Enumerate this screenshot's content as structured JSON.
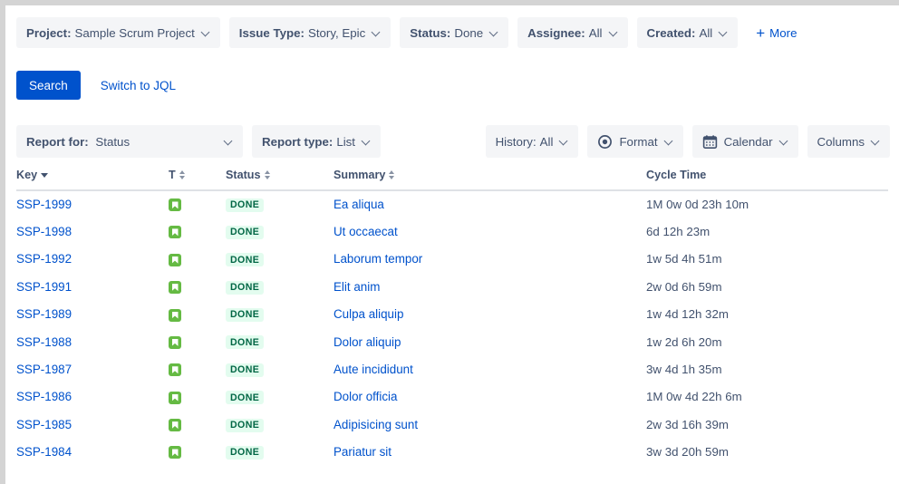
{
  "filters": [
    {
      "label": "Project:",
      "value": "Sample Scrum Project",
      "name": "filter-project"
    },
    {
      "label": "Issue Type:",
      "value": "Story, Epic",
      "name": "filter-issue-type"
    },
    {
      "label": "Status:",
      "value": "Done",
      "name": "filter-status"
    },
    {
      "label": "Assignee:",
      "value": "All",
      "name": "filter-assignee"
    },
    {
      "label": "Created:",
      "value": "All",
      "name": "filter-created"
    }
  ],
  "more_button": {
    "plus": "+",
    "label": "More"
  },
  "actions": {
    "search_label": "Search",
    "jql_label": "Switch to JQL"
  },
  "report_controls": {
    "report_for_label": "Report for:",
    "report_for_value": "Status",
    "report_type_label": "Report type:",
    "report_type_value": "List",
    "history_label": "History:",
    "history_value": "All",
    "format_label": "Format",
    "calendar_label": "Calendar",
    "columns_label": "Columns"
  },
  "table": {
    "headers": {
      "key": "Key",
      "type": "T",
      "status": "Status",
      "summary": "Summary",
      "cycle_time": "Cycle Time"
    },
    "rows": [
      {
        "key": "SSP-1999",
        "type_icon": "story-icon",
        "status": "DONE",
        "summary": "Ea aliqua",
        "cycle_time": "1M 0w 0d 23h 10m"
      },
      {
        "key": "SSP-1998",
        "type_icon": "story-icon",
        "status": "DONE",
        "summary": "Ut occaecat",
        "cycle_time": "6d 12h 23m"
      },
      {
        "key": "SSP-1992",
        "type_icon": "story-icon",
        "status": "DONE",
        "summary": "Laborum tempor",
        "cycle_time": "1w 5d 4h 51m"
      },
      {
        "key": "SSP-1991",
        "type_icon": "story-icon",
        "status": "DONE",
        "summary": "Elit anim",
        "cycle_time": "2w 0d 6h 59m"
      },
      {
        "key": "SSP-1989",
        "type_icon": "story-icon",
        "status": "DONE",
        "summary": "Culpa aliquip",
        "cycle_time": "1w 4d 12h 32m"
      },
      {
        "key": "SSP-1988",
        "type_icon": "story-icon",
        "status": "DONE",
        "summary": "Dolor aliquip",
        "cycle_time": "1w 2d 6h 20m"
      },
      {
        "key": "SSP-1987",
        "type_icon": "story-icon",
        "status": "DONE",
        "summary": "Aute incididunt",
        "cycle_time": "3w 4d 1h 35m"
      },
      {
        "key": "SSP-1986",
        "type_icon": "story-icon",
        "status": "DONE",
        "summary": "Dolor officia",
        "cycle_time": "1M 0w 4d 22h 6m"
      },
      {
        "key": "SSP-1985",
        "type_icon": "story-icon",
        "status": "DONE",
        "summary": "Adipisicing sunt",
        "cycle_time": "2w 3d 16h 39m"
      },
      {
        "key": "SSP-1984",
        "type_icon": "story-icon",
        "status": "DONE",
        "summary": "Pariatur sit",
        "cycle_time": "3w 3d 20h 59m"
      }
    ]
  },
  "colors": {
    "primary": "#0052CC",
    "text": "#42526E",
    "status_bg": "#E3FCEF",
    "status_fg": "#006644",
    "story_icon": "#65BA43",
    "pill_bg": "#F4F5F7"
  }
}
